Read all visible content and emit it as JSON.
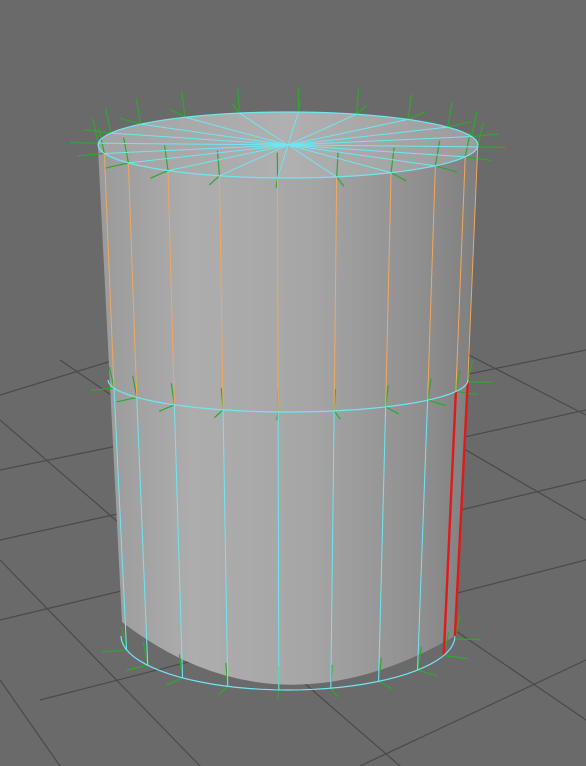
{
  "viewport": {
    "background": "#6a6a6a",
    "grid_color": "#484848"
  },
  "mesh": {
    "object": "cylinder",
    "surface_color": "#a8a8a8",
    "wire_color": "#6fe6f2",
    "soft_select_color": "#f0a860",
    "selected_edge_color": "#e01a1a",
    "normal_color": "#2ea82e"
  }
}
